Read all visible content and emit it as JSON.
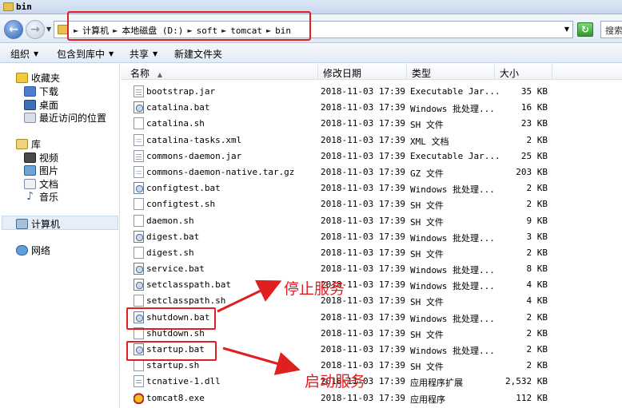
{
  "window": {
    "title": "bin"
  },
  "address": {
    "crumbs": [
      "计算机",
      "本地磁盘 (D:)",
      "soft",
      "tomcat",
      "bin"
    ],
    "search_placeholder": "搜索"
  },
  "toolbar": {
    "organize": "组织",
    "include_library": "包含到库中",
    "share": "共享",
    "new_folder": "新建文件夹"
  },
  "nav": {
    "favorites": "收藏夹",
    "downloads": "下载",
    "desktop": "桌面",
    "recent": "最近访问的位置",
    "libraries": "库",
    "videos": "视频",
    "pictures": "图片",
    "documents": "文档",
    "music": "音乐",
    "computer": "计算机",
    "network": "网络"
  },
  "columns": {
    "name": "名称",
    "date": "修改日期",
    "type": "类型",
    "size": "大小"
  },
  "files": [
    {
      "name": "bootstrap.jar",
      "date": "2018-11-03 17:39",
      "type": "Executable Jar...",
      "size": "35 KB",
      "icon": "jar"
    },
    {
      "name": "catalina.bat",
      "date": "2018-11-03 17:39",
      "type": "Windows 批处理...",
      "size": "16 KB",
      "icon": "bat"
    },
    {
      "name": "catalina.sh",
      "date": "2018-11-03 17:39",
      "type": "SH 文件",
      "size": "23 KB",
      "icon": "sh"
    },
    {
      "name": "catalina-tasks.xml",
      "date": "2018-11-03 17:39",
      "type": "XML 文档",
      "size": "2 KB",
      "icon": "xml"
    },
    {
      "name": "commons-daemon.jar",
      "date": "2018-11-03 17:39",
      "type": "Executable Jar...",
      "size": "25 KB",
      "icon": "jar"
    },
    {
      "name": "commons-daemon-native.tar.gz",
      "date": "2018-11-03 17:39",
      "type": "GZ 文件",
      "size": "203 KB",
      "icon": "gz"
    },
    {
      "name": "configtest.bat",
      "date": "2018-11-03 17:39",
      "type": "Windows 批处理...",
      "size": "2 KB",
      "icon": "bat"
    },
    {
      "name": "configtest.sh",
      "date": "2018-11-03 17:39",
      "type": "SH 文件",
      "size": "2 KB",
      "icon": "sh"
    },
    {
      "name": "daemon.sh",
      "date": "2018-11-03 17:39",
      "type": "SH 文件",
      "size": "9 KB",
      "icon": "sh"
    },
    {
      "name": "digest.bat",
      "date": "2018-11-03 17:39",
      "type": "Windows 批处理...",
      "size": "3 KB",
      "icon": "bat"
    },
    {
      "name": "digest.sh",
      "date": "2018-11-03 17:39",
      "type": "SH 文件",
      "size": "2 KB",
      "icon": "sh"
    },
    {
      "name": "service.bat",
      "date": "2018-11-03 17:39",
      "type": "Windows 批处理...",
      "size": "8 KB",
      "icon": "bat"
    },
    {
      "name": "setclasspath.bat",
      "date": "2018-11-03 17:39",
      "type": "Windows 批处理...",
      "size": "4 KB",
      "icon": "bat"
    },
    {
      "name": "setclasspath.sh",
      "date": "2018-11-03 17:39",
      "type": "SH 文件",
      "size": "4 KB",
      "icon": "sh"
    },
    {
      "name": "shutdown.bat",
      "date": "2018-11-03 17:39",
      "type": "Windows 批处理...",
      "size": "2 KB",
      "icon": "bat"
    },
    {
      "name": "shutdown.sh",
      "date": "2018-11-03 17:39",
      "type": "SH 文件",
      "size": "2 KB",
      "icon": "sh"
    },
    {
      "name": "startup.bat",
      "date": "2018-11-03 17:39",
      "type": "Windows 批处理...",
      "size": "2 KB",
      "icon": "bat"
    },
    {
      "name": "startup.sh",
      "date": "2018-11-03 17:39",
      "type": "SH 文件",
      "size": "2 KB",
      "icon": "sh"
    },
    {
      "name": "tcnative-1.dll",
      "date": "2018-11-03 17:39",
      "type": "应用程序扩展",
      "size": "2,532 KB",
      "icon": "dll"
    },
    {
      "name": "tomcat8.exe",
      "date": "2018-11-03 17:39",
      "type": "应用程序",
      "size": "112 KB",
      "icon": "exe"
    }
  ],
  "annotations": {
    "stop_service": "停止服务",
    "start_service": "启动服务"
  },
  "colors": {
    "annotation_red": "#e02020"
  }
}
